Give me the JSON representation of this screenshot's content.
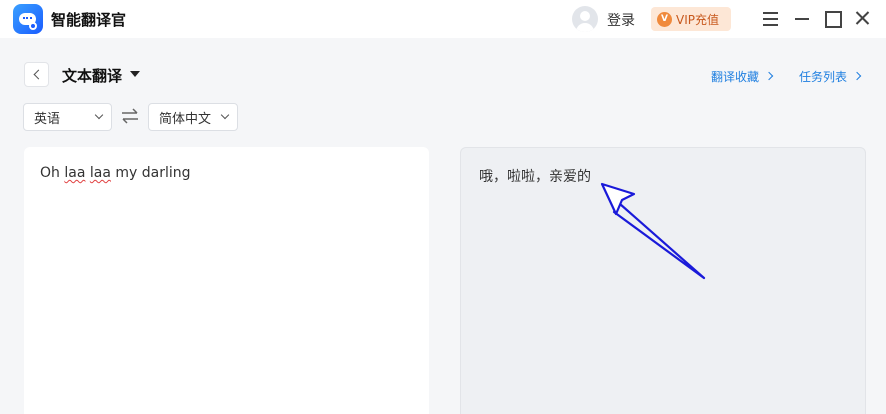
{
  "app": {
    "title": "智能翻译官"
  },
  "header": {
    "login_label": "登录",
    "vip_badge": "V",
    "vip_label": "VIP充值"
  },
  "page": {
    "title": "文本翻译"
  },
  "links": {
    "favorites": "翻译收藏",
    "tasks": "任务列表"
  },
  "languages": {
    "source": "英语",
    "target": "简体中文"
  },
  "source": {
    "text_parts": [
      "Oh ",
      "laa",
      " ",
      "laa",
      " my darling"
    ]
  },
  "result": {
    "text": "哦，啦啦，亲爱的"
  },
  "colors": {
    "accent_link": "#1f7fe0",
    "vip_bg": "#fde7d6",
    "vip_text": "#c8581c",
    "annotation_arrow": "#1a1ad9"
  },
  "icons": [
    "app-logo-icon",
    "avatar-icon",
    "menu-icon",
    "minimize-icon",
    "maximize-icon",
    "close-icon",
    "back-icon",
    "caret-down-icon",
    "swap-icon",
    "chevron-right-icon",
    "annotation-arrow-icon"
  ]
}
